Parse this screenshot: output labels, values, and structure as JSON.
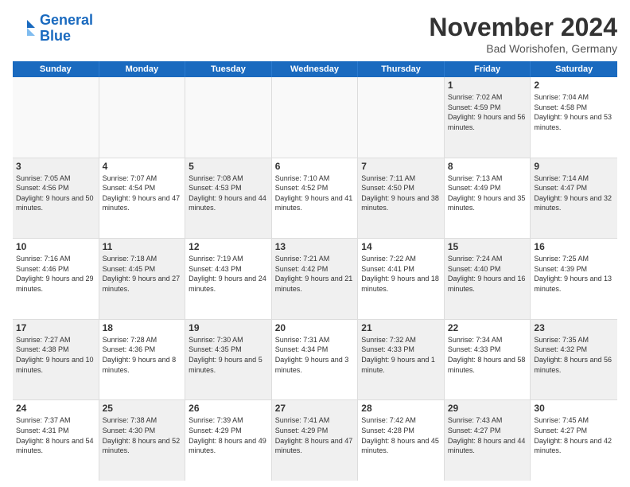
{
  "logo": {
    "line1": "General",
    "line2": "Blue"
  },
  "title": "November 2024",
  "location": "Bad Worishofen, Germany",
  "weekdays": [
    "Sunday",
    "Monday",
    "Tuesday",
    "Wednesday",
    "Thursday",
    "Friday",
    "Saturday"
  ],
  "rows": [
    [
      {
        "day": "",
        "info": "",
        "empty": true
      },
      {
        "day": "",
        "info": "",
        "empty": true
      },
      {
        "day": "",
        "info": "",
        "empty": true
      },
      {
        "day": "",
        "info": "",
        "empty": true
      },
      {
        "day": "",
        "info": "",
        "empty": true
      },
      {
        "day": "1",
        "info": "Sunrise: 7:02 AM\nSunset: 4:59 PM\nDaylight: 9 hours and 56 minutes.",
        "shaded": true
      },
      {
        "day": "2",
        "info": "Sunrise: 7:04 AM\nSunset: 4:58 PM\nDaylight: 9 hours and 53 minutes.",
        "shaded": false
      }
    ],
    [
      {
        "day": "3",
        "info": "Sunrise: 7:05 AM\nSunset: 4:56 PM\nDaylight: 9 hours and 50 minutes.",
        "shaded": true
      },
      {
        "day": "4",
        "info": "Sunrise: 7:07 AM\nSunset: 4:54 PM\nDaylight: 9 hours and 47 minutes.",
        "shaded": false
      },
      {
        "day": "5",
        "info": "Sunrise: 7:08 AM\nSunset: 4:53 PM\nDaylight: 9 hours and 44 minutes.",
        "shaded": true
      },
      {
        "day": "6",
        "info": "Sunrise: 7:10 AM\nSunset: 4:52 PM\nDaylight: 9 hours and 41 minutes.",
        "shaded": false
      },
      {
        "day": "7",
        "info": "Sunrise: 7:11 AM\nSunset: 4:50 PM\nDaylight: 9 hours and 38 minutes.",
        "shaded": true
      },
      {
        "day": "8",
        "info": "Sunrise: 7:13 AM\nSunset: 4:49 PM\nDaylight: 9 hours and 35 minutes.",
        "shaded": false
      },
      {
        "day": "9",
        "info": "Sunrise: 7:14 AM\nSunset: 4:47 PM\nDaylight: 9 hours and 32 minutes.",
        "shaded": true
      }
    ],
    [
      {
        "day": "10",
        "info": "Sunrise: 7:16 AM\nSunset: 4:46 PM\nDaylight: 9 hours and 29 minutes.",
        "shaded": false
      },
      {
        "day": "11",
        "info": "Sunrise: 7:18 AM\nSunset: 4:45 PM\nDaylight: 9 hours and 27 minutes.",
        "shaded": true
      },
      {
        "day": "12",
        "info": "Sunrise: 7:19 AM\nSunset: 4:43 PM\nDaylight: 9 hours and 24 minutes.",
        "shaded": false
      },
      {
        "day": "13",
        "info": "Sunrise: 7:21 AM\nSunset: 4:42 PM\nDaylight: 9 hours and 21 minutes.",
        "shaded": true
      },
      {
        "day": "14",
        "info": "Sunrise: 7:22 AM\nSunset: 4:41 PM\nDaylight: 9 hours and 18 minutes.",
        "shaded": false
      },
      {
        "day": "15",
        "info": "Sunrise: 7:24 AM\nSunset: 4:40 PM\nDaylight: 9 hours and 16 minutes.",
        "shaded": true
      },
      {
        "day": "16",
        "info": "Sunrise: 7:25 AM\nSunset: 4:39 PM\nDaylight: 9 hours and 13 minutes.",
        "shaded": false
      }
    ],
    [
      {
        "day": "17",
        "info": "Sunrise: 7:27 AM\nSunset: 4:38 PM\nDaylight: 9 hours and 10 minutes.",
        "shaded": true
      },
      {
        "day": "18",
        "info": "Sunrise: 7:28 AM\nSunset: 4:36 PM\nDaylight: 9 hours and 8 minutes.",
        "shaded": false
      },
      {
        "day": "19",
        "info": "Sunrise: 7:30 AM\nSunset: 4:35 PM\nDaylight: 9 hours and 5 minutes.",
        "shaded": true
      },
      {
        "day": "20",
        "info": "Sunrise: 7:31 AM\nSunset: 4:34 PM\nDaylight: 9 hours and 3 minutes.",
        "shaded": false
      },
      {
        "day": "21",
        "info": "Sunrise: 7:32 AM\nSunset: 4:33 PM\nDaylight: 9 hours and 1 minute.",
        "shaded": true
      },
      {
        "day": "22",
        "info": "Sunrise: 7:34 AM\nSunset: 4:33 PM\nDaylight: 8 hours and 58 minutes.",
        "shaded": false
      },
      {
        "day": "23",
        "info": "Sunrise: 7:35 AM\nSunset: 4:32 PM\nDaylight: 8 hours and 56 minutes.",
        "shaded": true
      }
    ],
    [
      {
        "day": "24",
        "info": "Sunrise: 7:37 AM\nSunset: 4:31 PM\nDaylight: 8 hours and 54 minutes.",
        "shaded": false
      },
      {
        "day": "25",
        "info": "Sunrise: 7:38 AM\nSunset: 4:30 PM\nDaylight: 8 hours and 52 minutes.",
        "shaded": true
      },
      {
        "day": "26",
        "info": "Sunrise: 7:39 AM\nSunset: 4:29 PM\nDaylight: 8 hours and 49 minutes.",
        "shaded": false
      },
      {
        "day": "27",
        "info": "Sunrise: 7:41 AM\nSunset: 4:29 PM\nDaylight: 8 hours and 47 minutes.",
        "shaded": true
      },
      {
        "day": "28",
        "info": "Sunrise: 7:42 AM\nSunset: 4:28 PM\nDaylight: 8 hours and 45 minutes.",
        "shaded": false
      },
      {
        "day": "29",
        "info": "Sunrise: 7:43 AM\nSunset: 4:27 PM\nDaylight: 8 hours and 44 minutes.",
        "shaded": true
      },
      {
        "day": "30",
        "info": "Sunrise: 7:45 AM\nSunset: 4:27 PM\nDaylight: 8 hours and 42 minutes.",
        "shaded": false
      }
    ]
  ]
}
